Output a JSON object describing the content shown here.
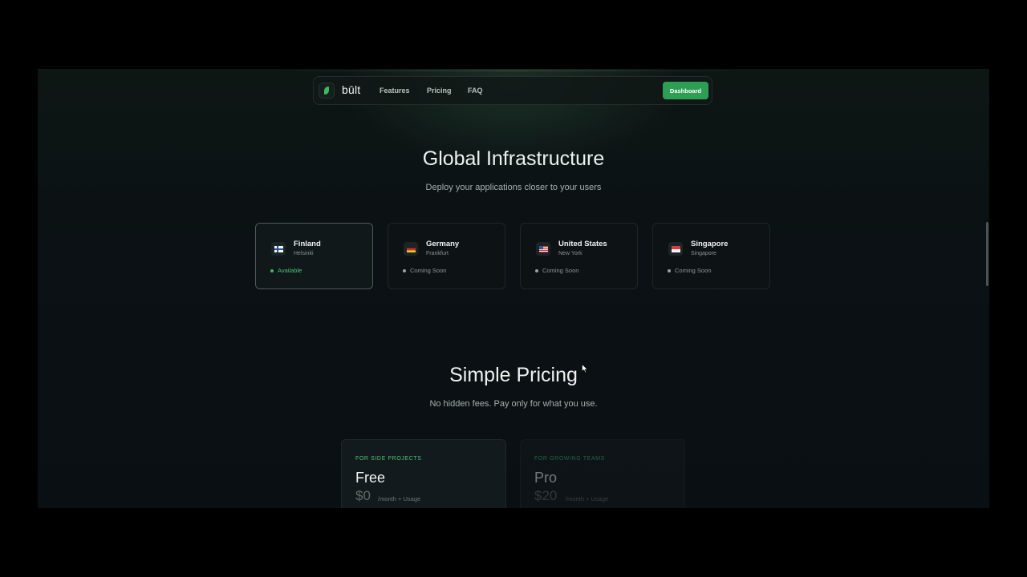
{
  "nav": {
    "brand": "būlt",
    "links": [
      "Features",
      "Pricing",
      "FAQ"
    ],
    "cta": "Dashboard"
  },
  "infrastructure": {
    "title": "Global Infrastructure",
    "subtitle": "Deploy your applications closer to your users",
    "regions": [
      {
        "country": "Finland",
        "city": "Helsinki",
        "status": "Available",
        "flag": "finland-flag-icon"
      },
      {
        "country": "Germany",
        "city": "Frankfurt",
        "status": "Coming Soon",
        "flag": "germany-flag-icon"
      },
      {
        "country": "United States",
        "city": "New York",
        "status": "Coming Soon",
        "flag": "usa-flag-icon"
      },
      {
        "country": "Singapore",
        "city": "Singapore",
        "status": "Coming Soon",
        "flag": "singapore-flag-icon"
      }
    ]
  },
  "pricing": {
    "title": "Simple Pricing",
    "subtitle": "No hidden fees. Pay only for what you use.",
    "plans": [
      {
        "tag": "FOR SIDE PROJECTS",
        "name": "Free",
        "price": "$0",
        "unit": "/month + Usage"
      },
      {
        "tag": "FOR GROWING TEAMS",
        "name": "Pro",
        "price": "$20",
        "unit": "/month + Usage"
      }
    ]
  },
  "colors": {
    "accent": "#2f9e55",
    "available": "#4cc274",
    "background": "#0b1114"
  }
}
